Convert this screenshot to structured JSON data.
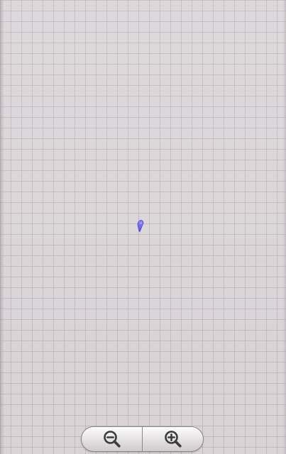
{
  "map": {
    "background_color": "#d9d3d6",
    "grid_color": "#b0a4ac",
    "marker": {
      "icon": "location-marker-icon",
      "color": "#6b63ff"
    }
  },
  "zoom_controls": {
    "zoom_out": {
      "icon": "zoom-out-icon"
    },
    "zoom_in": {
      "icon": "zoom-in-icon"
    }
  }
}
